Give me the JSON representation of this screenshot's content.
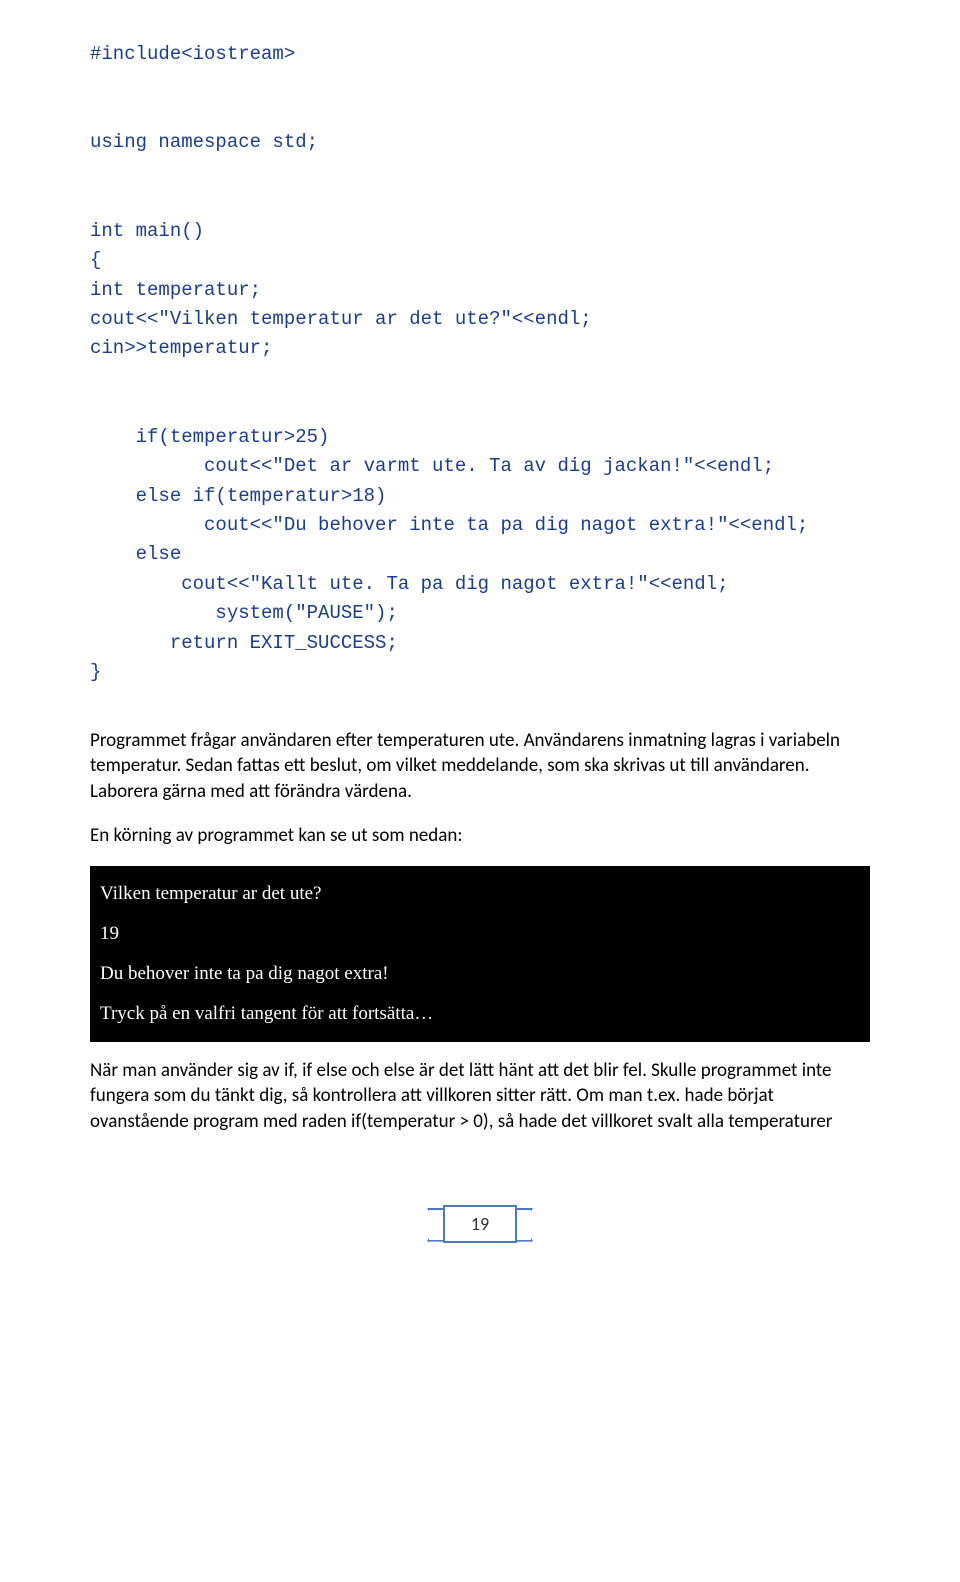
{
  "code": "#include<iostream>\n\n\nusing namespace std;\n\n\nint main()\n{\nint temperatur;\ncout<<\"Vilken temperatur ar det ute?\"<<endl;\ncin>>temperatur;\n\n\n    if(temperatur>25)\n          cout<<\"Det ar varmt ute. Ta av dig jackan!\"<<endl;\n    else if(temperatur>18)\n          cout<<\"Du behover inte ta pa dig nagot extra!\"<<endl;\n    else\n        cout<<\"Kallt ute. Ta pa dig nagot extra!\"<<endl;\n           system(\"PAUSE\");\n       return EXIT_SUCCESS;\n}",
  "para1": "Programmet frågar användaren efter temperaturen ute. Användarens inmatning lagras i variabeln temperatur. Sedan fattas ett beslut, om vilket meddelande, som ska skrivas ut till användaren. Laborera gärna med att förändra värdena.",
  "para2": "En körning av programmet kan se ut som nedan:",
  "console": "Vilken temperatur ar det ute?\n19\nDu behover inte ta pa dig nagot extra!\nTryck på en valfri tangent för att fortsätta…",
  "para3": "När man använder sig av if, if else och else är det lätt hänt att det blir fel. Skulle programmet inte fungera som du tänkt dig, så kontrollera att villkoren sitter rätt. Om man t.ex. hade börjat ovanstående program med raden if(temperatur > 0), så hade det villkoret svalt alla temperaturer",
  "page_number": "19"
}
